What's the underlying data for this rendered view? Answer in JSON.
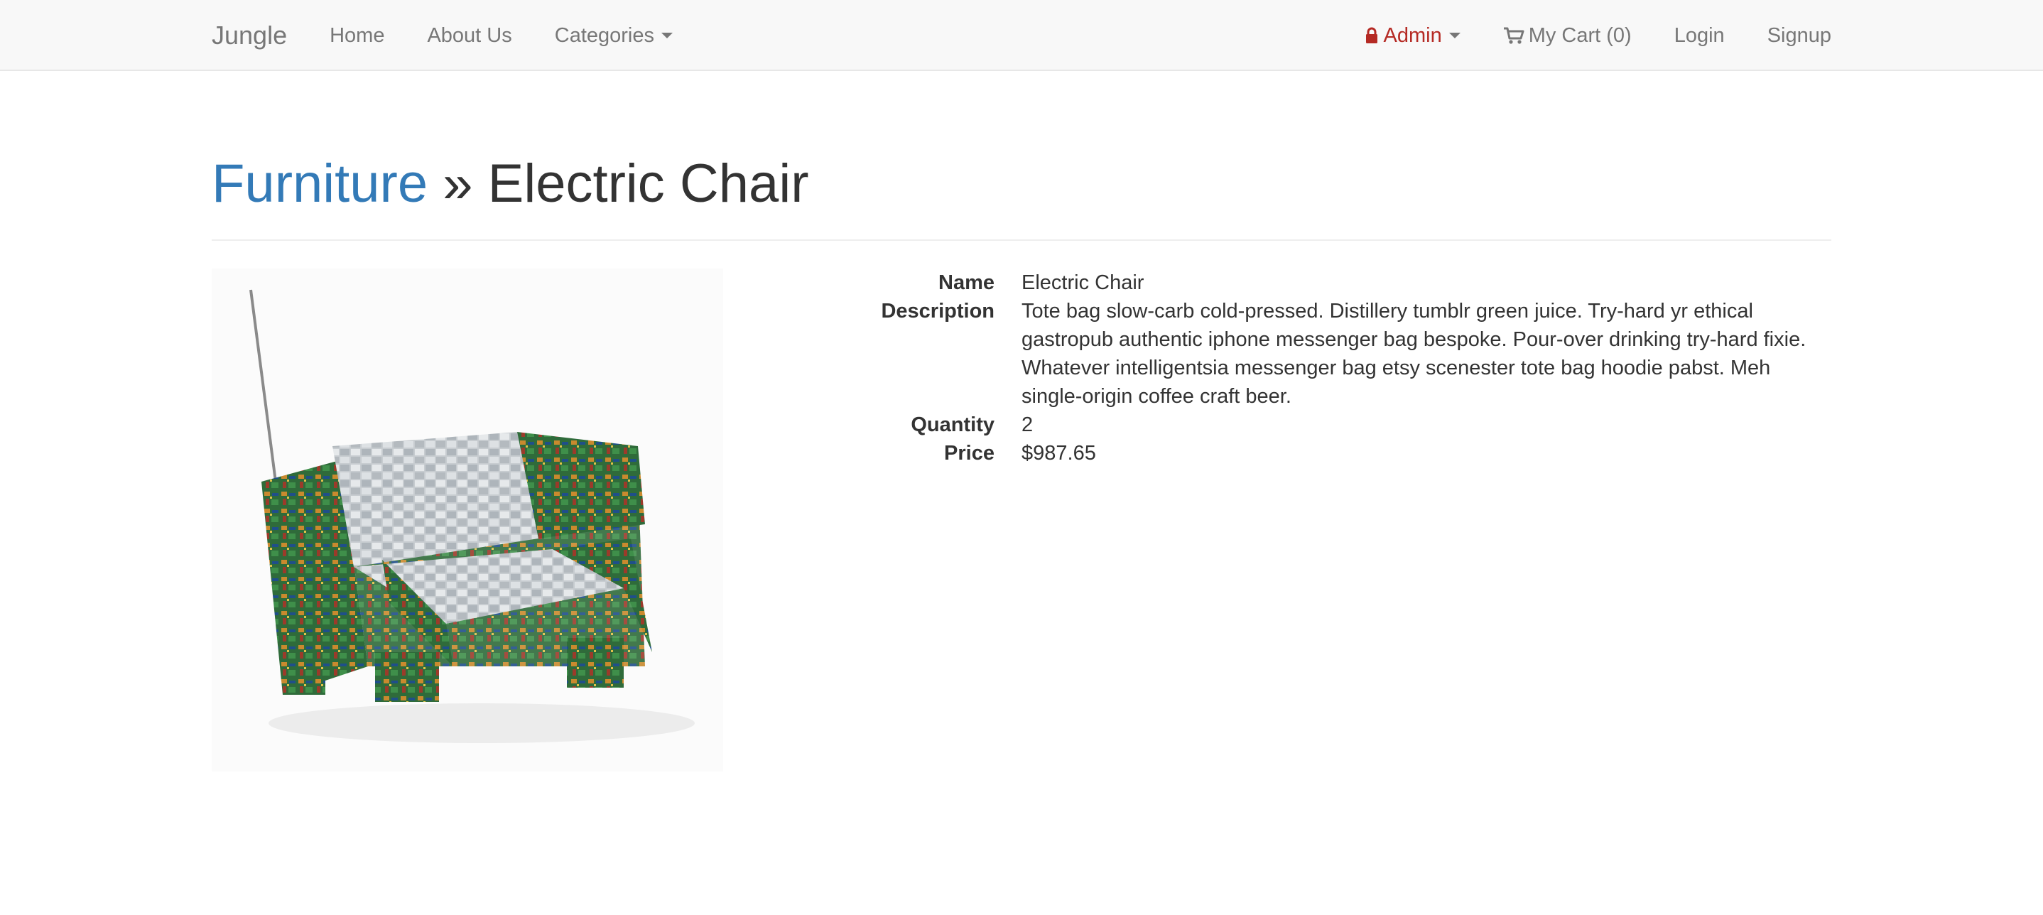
{
  "nav": {
    "brand": "Jungle",
    "home": "Home",
    "about": "About Us",
    "categories": "Categories",
    "admin": "Admin",
    "cart": "My Cart (0)",
    "login": "Login",
    "signup": "Signup"
  },
  "header": {
    "category": "Furniture",
    "separator": " » ",
    "product": "Electric Chair"
  },
  "product": {
    "name_label": "Name",
    "name": "Electric Chair",
    "description_label": "Description",
    "description": "Tote bag slow-carb cold-pressed. Distillery tumblr green juice. Try-hard yr ethical gastropub authentic iphone messenger bag bespoke. Pour-over drinking try-hard fixie. Whatever intelligentsia messenger bag etsy scenester tote bag hoodie pabst. Meh single-origin coffee craft beer.",
    "quantity_label": "Quantity",
    "quantity": "2",
    "price_label": "Price",
    "price": "$987.65"
  },
  "colors": {
    "link": "#337ab7",
    "admin": "#b52a24",
    "navbar_bg": "#f8f8f8"
  }
}
